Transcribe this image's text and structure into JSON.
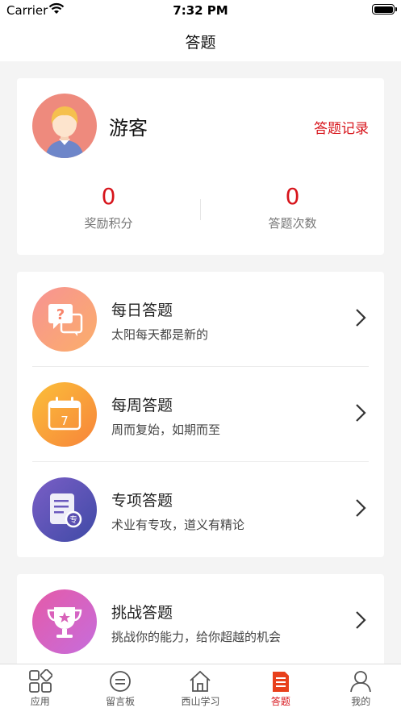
{
  "status_bar": {
    "carrier": "Carrier",
    "time": "7:32 PM"
  },
  "nav": {
    "title": "答题"
  },
  "profile": {
    "username": "游客",
    "record_link": "答题记录",
    "stats": [
      {
        "value": "0",
        "label": "奖励积分"
      },
      {
        "value": "0",
        "label": "答题次数"
      }
    ]
  },
  "quiz_items": [
    {
      "title": "每日答题",
      "subtitle": "太阳每天都是新的",
      "icon": "question-chat-icon",
      "color": "#f8846a"
    },
    {
      "title": "每周答题",
      "subtitle": "周而复始，如期而至",
      "icon": "calendar-icon",
      "color": "#f9a23b"
    },
    {
      "title": "专项答题",
      "subtitle": "术业有专攻，道义有精论",
      "icon": "document-icon",
      "color": "#5f53b4"
    },
    {
      "title": "挑战答题",
      "subtitle": "挑战你的能力，给你超越的机会",
      "icon": "trophy-icon",
      "color": "#d863b9"
    }
  ],
  "tabs": [
    {
      "label": "应用",
      "icon": "apps-grid-icon"
    },
    {
      "label": "留言板",
      "icon": "message-icon"
    },
    {
      "label": "西山学习",
      "icon": "home-icon"
    },
    {
      "label": "答题",
      "icon": "quiz-doc-icon",
      "active": true
    },
    {
      "label": "我的",
      "icon": "user-icon"
    }
  ],
  "colors": {
    "accent": "#d7141b",
    "background": "#f4f4f4"
  }
}
